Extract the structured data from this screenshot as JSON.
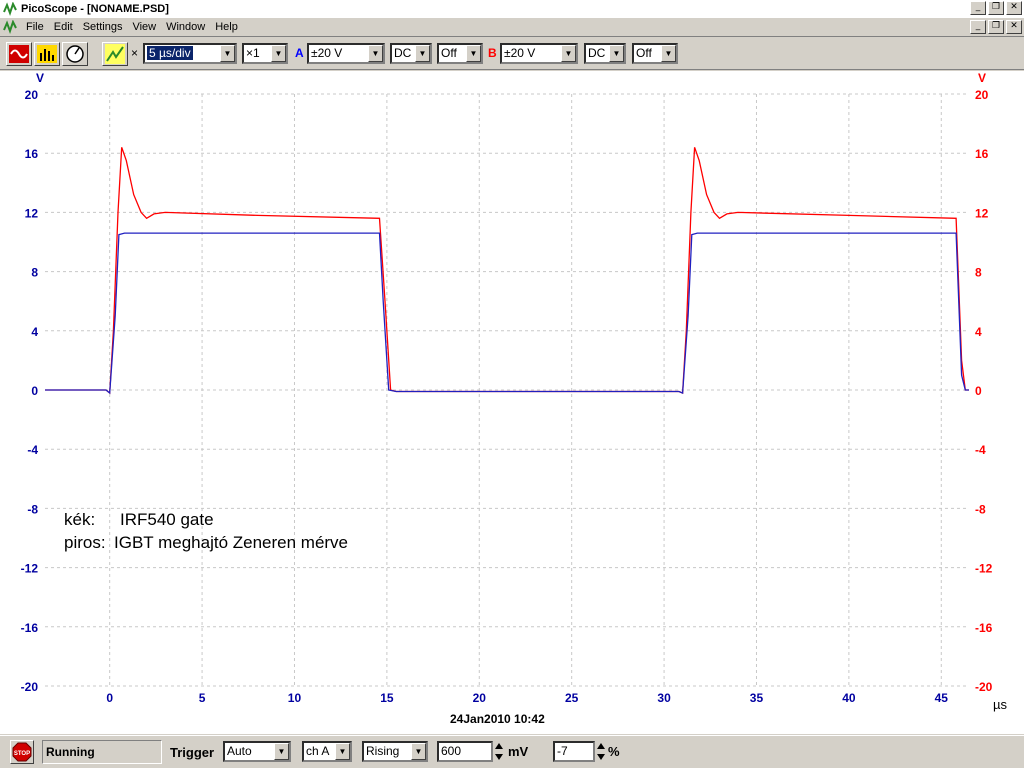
{
  "window": {
    "title": "PicoScope - [NONAME.PSD]"
  },
  "menu": [
    "File",
    "Edit",
    "Settings",
    "View",
    "Window",
    "Help"
  ],
  "toolbar": {
    "timebase": "5 µs/div",
    "multiplier": "×1",
    "x_mark": "×",
    "channel_a": {
      "label": "A",
      "range": "±20 V",
      "coupling": "DC",
      "filter": "Off",
      "color": "#0000ff"
    },
    "channel_b": {
      "label": "B",
      "range": "±20 V",
      "coupling": "DC",
      "filter": "Off",
      "color": "#ff0000"
    }
  },
  "annotation": {
    "line1_key": "kék:",
    "line1_val": "IRF540 gate",
    "line2_key": "piros:",
    "line2_val": "IGBT meghajtó Zeneren mérve"
  },
  "axes": {
    "left_unit": "V",
    "right_unit": "V",
    "x_unit": "µs",
    "timestamp": "24Jan2010  10:42"
  },
  "status": {
    "state": "Running",
    "trigger_label": "Trigger",
    "trigger_mode": "Auto",
    "trigger_channel": "ch A",
    "trigger_edge": "Rising",
    "trigger_level": "600",
    "trigger_level_unit": "mV",
    "pretrigger": "-7",
    "pretrigger_unit": "%"
  },
  "chart_data": {
    "type": "line",
    "xlim": [
      -3.5,
      46.5
    ],
    "ylim": [
      -20,
      20
    ],
    "x_ticks": [
      0,
      5,
      10,
      15,
      20,
      25,
      30,
      35,
      40,
      45
    ],
    "y_ticks": [
      -20,
      -16,
      -12,
      -8,
      -4,
      0,
      4,
      8,
      12,
      16,
      20
    ],
    "grid": true,
    "series": [
      {
        "color": "#2020c0",
        "points": [
          [
            -3.5,
            0
          ],
          [
            -0.2,
            0
          ],
          [
            0,
            -0.2
          ],
          [
            0.3,
            5
          ],
          [
            0.5,
            10.5
          ],
          [
            0.8,
            10.6
          ],
          [
            14.6,
            10.6
          ],
          [
            14.8,
            6
          ],
          [
            15.1,
            0
          ],
          [
            15.5,
            -0.1
          ],
          [
            30.8,
            -0.1
          ],
          [
            31.0,
            -0.2
          ],
          [
            31.3,
            5
          ],
          [
            31.5,
            10.5
          ],
          [
            31.8,
            10.6
          ],
          [
            45.8,
            10.6
          ],
          [
            46.1,
            1
          ],
          [
            46.3,
            0
          ],
          [
            46.5,
            0
          ]
        ]
      },
      {
        "color": "#ff0000",
        "points": [
          [
            -3.5,
            0
          ],
          [
            -0.2,
            0
          ],
          [
            0,
            -0.2
          ],
          [
            0.2,
            4
          ],
          [
            0.45,
            12
          ],
          [
            0.65,
            16.4
          ],
          [
            0.9,
            15.5
          ],
          [
            1.3,
            13.2
          ],
          [
            1.7,
            12
          ],
          [
            2,
            11.6
          ],
          [
            2.4,
            11.9
          ],
          [
            3,
            12
          ],
          [
            8,
            11.8
          ],
          [
            14.6,
            11.6
          ],
          [
            14.9,
            6
          ],
          [
            15.2,
            0
          ],
          [
            15.5,
            -0.1
          ],
          [
            30.8,
            -0.1
          ],
          [
            31.0,
            -0.2
          ],
          [
            31.2,
            4
          ],
          [
            31.45,
            12
          ],
          [
            31.65,
            16.4
          ],
          [
            31.9,
            15.5
          ],
          [
            32.3,
            13.2
          ],
          [
            32.7,
            12
          ],
          [
            33,
            11.6
          ],
          [
            33.4,
            11.9
          ],
          [
            34,
            12
          ],
          [
            40,
            11.8
          ],
          [
            45.8,
            11.6
          ],
          [
            46.1,
            2
          ],
          [
            46.3,
            0
          ],
          [
            46.5,
            0
          ]
        ]
      }
    ]
  }
}
